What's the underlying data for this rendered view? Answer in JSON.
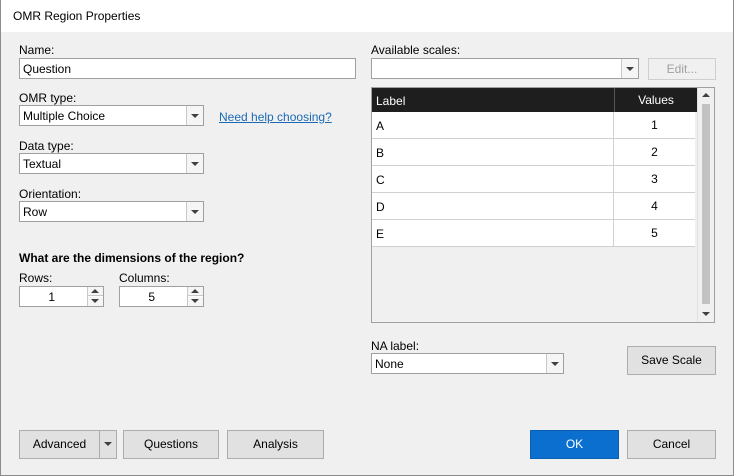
{
  "window": {
    "title": "OMR Region Properties"
  },
  "name": {
    "label": "Name:",
    "value": "Question"
  },
  "omr_type": {
    "label": "OMR type:",
    "value": "Multiple Choice",
    "help_link": "Need help choosing?"
  },
  "data_type": {
    "label": "Data type:",
    "value": "Textual"
  },
  "orientation": {
    "label": "Orientation:",
    "value": "Row"
  },
  "dimensions": {
    "heading": "What are the dimensions of the region?",
    "rows_label": "Rows:",
    "rows_value": "1",
    "columns_label": "Columns:",
    "columns_value": "5"
  },
  "scales": {
    "label": "Available scales:",
    "value": "",
    "edit_button": "Edit...",
    "columns": [
      "Label",
      "Values"
    ],
    "rows": [
      {
        "label": "A",
        "value": "1"
      },
      {
        "label": "B",
        "value": "2"
      },
      {
        "label": "C",
        "value": "3"
      },
      {
        "label": "D",
        "value": "4"
      },
      {
        "label": "E",
        "value": "5"
      }
    ]
  },
  "na": {
    "label": "NA label:",
    "value": "None"
  },
  "buttons": {
    "save_scale": "Save Scale",
    "advanced": "Advanced",
    "questions": "Questions",
    "analysis": "Analysis",
    "ok": "OK",
    "cancel": "Cancel"
  },
  "colors": {
    "accent": "#0a6fce",
    "link": "#1c6ab5",
    "grid_header": "#1e1e1e"
  }
}
